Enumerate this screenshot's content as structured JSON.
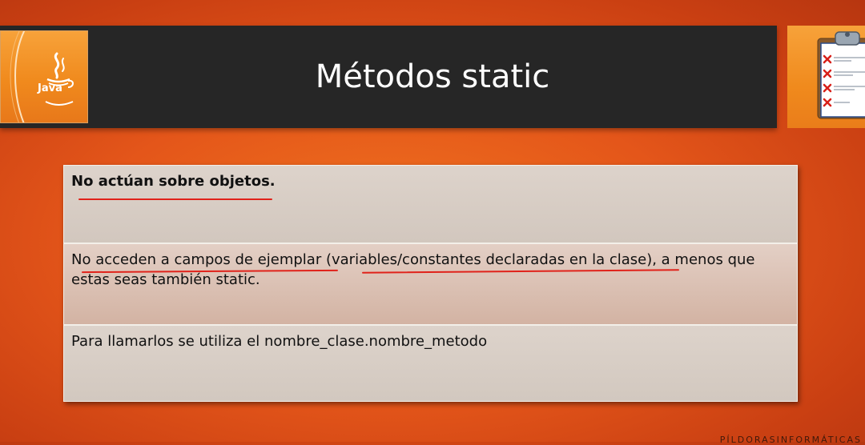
{
  "slide": {
    "title": "Métodos static",
    "logo_text": "Java"
  },
  "rows": [
    {
      "text": "No actúan sobre objetos."
    },
    {
      "text": "No acceden a campos de ejemplar (variables/constantes declaradas en la clase), a menos que estas seas también static."
    },
    {
      "text": "Para llamarlos se utiliza el nombre_clase.nombre_metodo"
    }
  ],
  "watermark": "PÍLDORASINFORMÁTICAS",
  "colors": {
    "background": "#e4561a",
    "title_bar": "#262626",
    "tile_orange": "#f08a1d",
    "underline_red": "#e0221a"
  },
  "icons": [
    "java-logo-icon",
    "checklist-clipboard-icon"
  ]
}
